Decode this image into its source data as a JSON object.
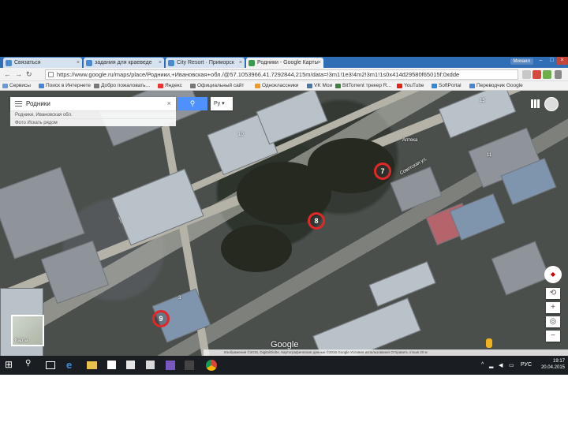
{
  "browser": {
    "tabs": [
      {
        "label": "Связаться",
        "active": false
      },
      {
        "label": "задания для краеведе",
        "active": false
      },
      {
        "label": "City Resort · Приморск",
        "active": false
      },
      {
        "label": "Родники - Google Карты",
        "active": true
      }
    ],
    "user_label": "Михаил",
    "url": "https://www.google.ru/maps/place/Родники,+Ивановская+обл./@57.1053966,41.7292844,215m/data=!3m1!1e3!4m2!3m1!1s0x414d29580f65015f:0xdde",
    "bookmarks": [
      "Сервисы",
      "Поиск в Интернете",
      "Добро пожаловать...",
      "Яндекс",
      "Официальный сайт",
      "Одноклассники",
      "VK Мои",
      "BitTorrent трекер R...",
      "YouTube",
      "SoftPortal",
      "Переводчик Google"
    ]
  },
  "map": {
    "search_value": "Родники",
    "search_button_icon": "search-icon",
    "lang_label": "Ру",
    "suggestions": [
      "Родники, Ивановская обл.",
      "Фото   Искать рядом"
    ],
    "markers": [
      "7",
      "8",
      "9"
    ],
    "labels": {
      "pharmacy": "Аптека",
      "street": "Советская ул.",
      "house_10": "10",
      "house_11": "11",
      "house_3": "3",
      "house_15": "15"
    },
    "earth_label": "Карта",
    "logo": "Google",
    "footer": "Изображения ©2015, DigitalGlobe, Картографические данные ©2015 Google   Условия использования   Отправить отзыв   20 м"
  },
  "taskbar": {
    "time": "19:17",
    "date": "20.04.2015",
    "lang": "РУС"
  },
  "colors": {
    "marker": "#e12828",
    "search_button": "#4d90fe",
    "tab_strip": "#2f6db5"
  }
}
